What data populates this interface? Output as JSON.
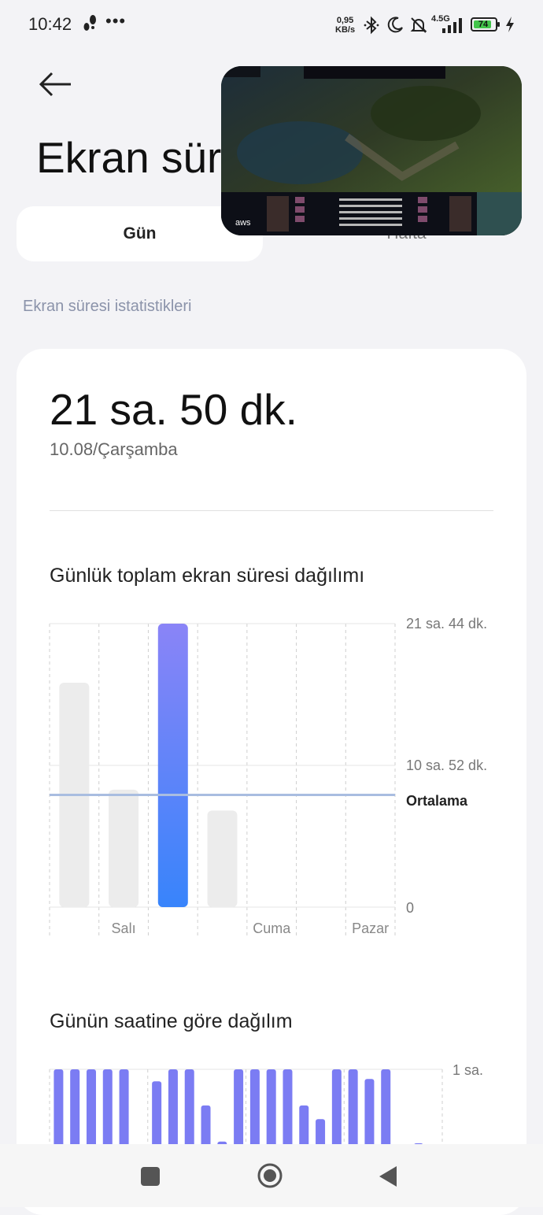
{
  "status_bar": {
    "time": "10:42",
    "dots": "•••",
    "net_speed_value": "0,95",
    "net_speed_unit": "KB/s",
    "network_type": "4.5G",
    "battery_level": "74"
  },
  "header": {
    "title": "Ekran sür",
    "icons": [
      "back-arrow-icon"
    ]
  },
  "tabs": [
    {
      "label": "Gün",
      "selected": true
    },
    {
      "label": "Hafta",
      "selected": false
    }
  ],
  "pip": {
    "description_icon": "video-thumbnail"
  },
  "section_label": "Ekran süresi istatistikleri",
  "summary": {
    "total_time": "21 sa. 50 dk.",
    "date": "10.08/Çarşamba"
  },
  "daily_chart_title": "Günlük toplam ekran süresi dağılımı",
  "hourly_chart_title": "Günün saatine göre dağılım",
  "chart_data": [
    {
      "type": "bar",
      "categories": [
        "",
        "Salı",
        "",
        "",
        "Cuma",
        "",
        "Pazar"
      ],
      "values": [
        17.2,
        9.0,
        21.8,
        7.4,
        0,
        0,
        0
      ],
      "highlight_index": 2,
      "ytick_labels": [
        "21 sa. 44 dk.",
        "10 sa. 52 dk.",
        "0"
      ],
      "ylim": [
        0,
        21.73
      ],
      "average_label": "Ortalama",
      "average_value": 8.6,
      "colors": {
        "highlight_top": "#8a84f7",
        "highlight_bottom": "#3884fb",
        "bar": "#ececec",
        "average": "#a9bde0"
      }
    },
    {
      "type": "bar",
      "values": [
        1,
        1,
        1,
        1,
        1,
        0,
        0.85,
        1,
        1,
        0.55,
        0.1,
        1,
        1,
        1,
        1,
        0.55,
        0.38,
        1,
        1,
        0.88,
        1,
        0,
        0.08
      ],
      "ytick_labels": [
        "1 sa."
      ],
      "ylim": [
        0,
        1
      ],
      "colors": {
        "bar": "#7b7cf3"
      }
    }
  ],
  "nav_bar": {
    "icons": [
      "square-recents-icon",
      "circle-home-icon",
      "triangle-back-icon"
    ]
  }
}
